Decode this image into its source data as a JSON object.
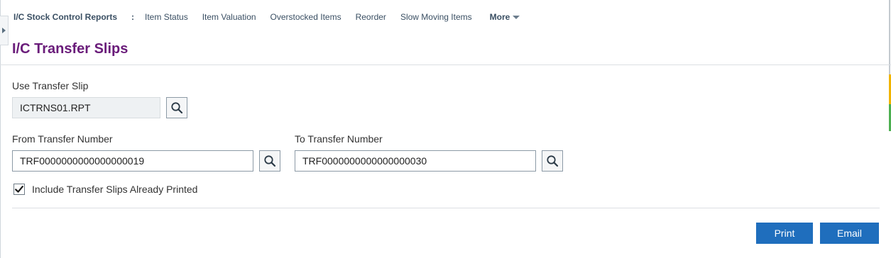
{
  "nav": {
    "title": "I/C Stock Control Reports",
    "separator": ":",
    "links": [
      "Item Status",
      "Item Valuation",
      "Overstocked Items",
      "Reorder",
      "Slow Moving Items"
    ],
    "more": "More"
  },
  "page": {
    "title": "I/C Transfer Slips"
  },
  "form": {
    "transfer_slip": {
      "label": "Use Transfer Slip",
      "value": "ICTRNS01.RPT"
    },
    "from_transfer": {
      "label": "From Transfer Number",
      "value": "TRF0000000000000000019"
    },
    "to_transfer": {
      "label": "To Transfer Number",
      "value": "TRF0000000000000000030"
    },
    "include_printed": {
      "label": "Include Transfer Slips Already Printed",
      "checked": true
    }
  },
  "actions": {
    "print": "Print",
    "email": "Email"
  },
  "colors": {
    "accent": "#1f6ebd",
    "title": "#6a1c7a",
    "status_orange": "#f0b400",
    "status_green": "#4caf50"
  },
  "icons": {
    "finder": "search-icon",
    "checkbox": "checkmark-icon",
    "more": "caret-down-icon",
    "sidebar": "expand-arrow-icon"
  }
}
